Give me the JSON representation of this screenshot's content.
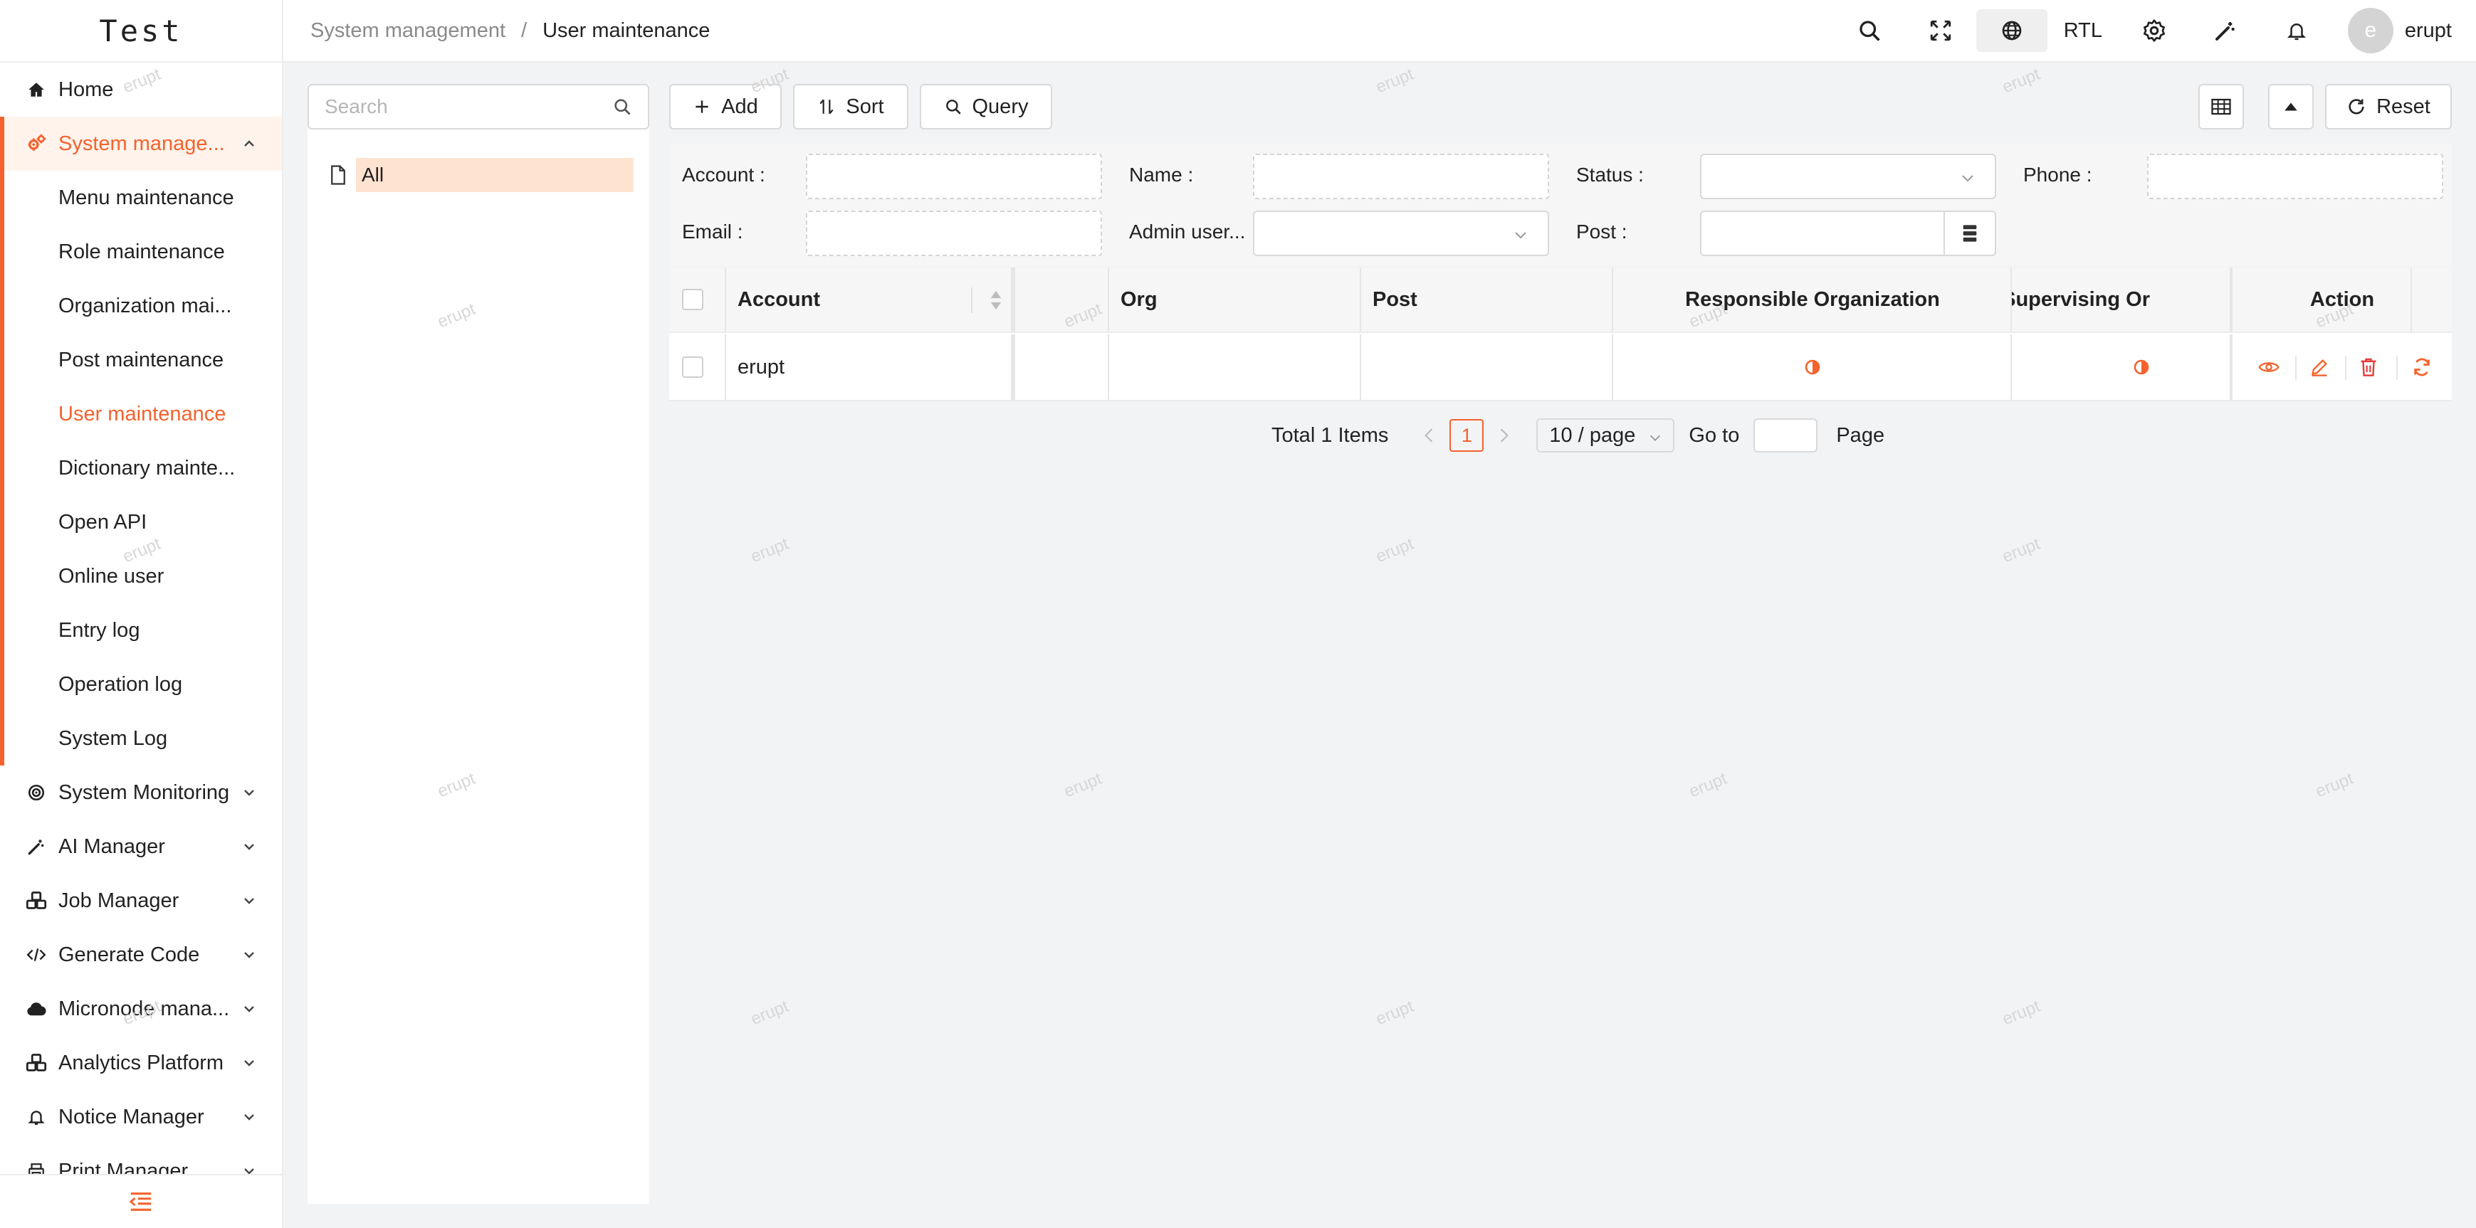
{
  "app": {
    "logo": "Test",
    "watermark": "erupt"
  },
  "colors": {
    "accent": "#f5622d",
    "active_bg": "#fff3ec",
    "danger": "#e53935"
  },
  "sidebar": {
    "items": [
      {
        "label": "Home",
        "icon": "home-icon"
      },
      {
        "label": "System manage...",
        "icon": "gears-icon",
        "open": true,
        "children": [
          {
            "label": "Menu maintenance"
          },
          {
            "label": "Role maintenance"
          },
          {
            "label": "Organization mai..."
          },
          {
            "label": "Post maintenance"
          },
          {
            "label": "User maintenance",
            "active": true
          },
          {
            "label": "Dictionary mainte..."
          },
          {
            "label": "Open API"
          },
          {
            "label": "Online user"
          },
          {
            "label": "Entry log"
          },
          {
            "label": "Operation log"
          },
          {
            "label": "System Log"
          }
        ]
      },
      {
        "label": "System Monitoring",
        "icon": "monitor-icon"
      },
      {
        "label": "AI Manager",
        "icon": "magic-wand-icon"
      },
      {
        "label": "Job Manager",
        "icon": "cubes-icon"
      },
      {
        "label": "Generate Code",
        "icon": "code-icon"
      },
      {
        "label": "Micronode mana...",
        "icon": "cloud-icon"
      },
      {
        "label": "Analytics Platform",
        "icon": "cubes-icon"
      },
      {
        "label": "Notice Manager",
        "icon": "bell-icon"
      },
      {
        "label": "Print Manager",
        "icon": "printer-icon"
      }
    ]
  },
  "header": {
    "breadcrumb": [
      "System management",
      "User maintenance"
    ],
    "separator": "/",
    "rtl_label": "RTL",
    "user": {
      "initial": "e",
      "name": "erupt"
    }
  },
  "tree": {
    "search_placeholder": "Search",
    "nodes": [
      {
        "label": "All",
        "selected": true
      }
    ]
  },
  "toolbar": {
    "add": "Add",
    "sort": "Sort",
    "query": "Query",
    "reset": "Reset"
  },
  "filters": {
    "account": "Account :",
    "name": "Name :",
    "status": "Status :",
    "phone": "Phone :",
    "email": "Email :",
    "admin_user": "Admin user...",
    "post": "Post :"
  },
  "table": {
    "columns": [
      "Account",
      "Org",
      "Post",
      "Responsible Organization",
      "Supervising Or",
      "Action"
    ],
    "rows": [
      {
        "account": "erupt",
        "org": "",
        "post": "",
        "responsible": "half-circle-icon",
        "supervising": "half-circle-icon"
      }
    ]
  },
  "pagination": {
    "total": "Total 1 Items",
    "current_page": "1",
    "page_size": "10 / page",
    "goto": "Go to",
    "page_suffix": "Page"
  }
}
